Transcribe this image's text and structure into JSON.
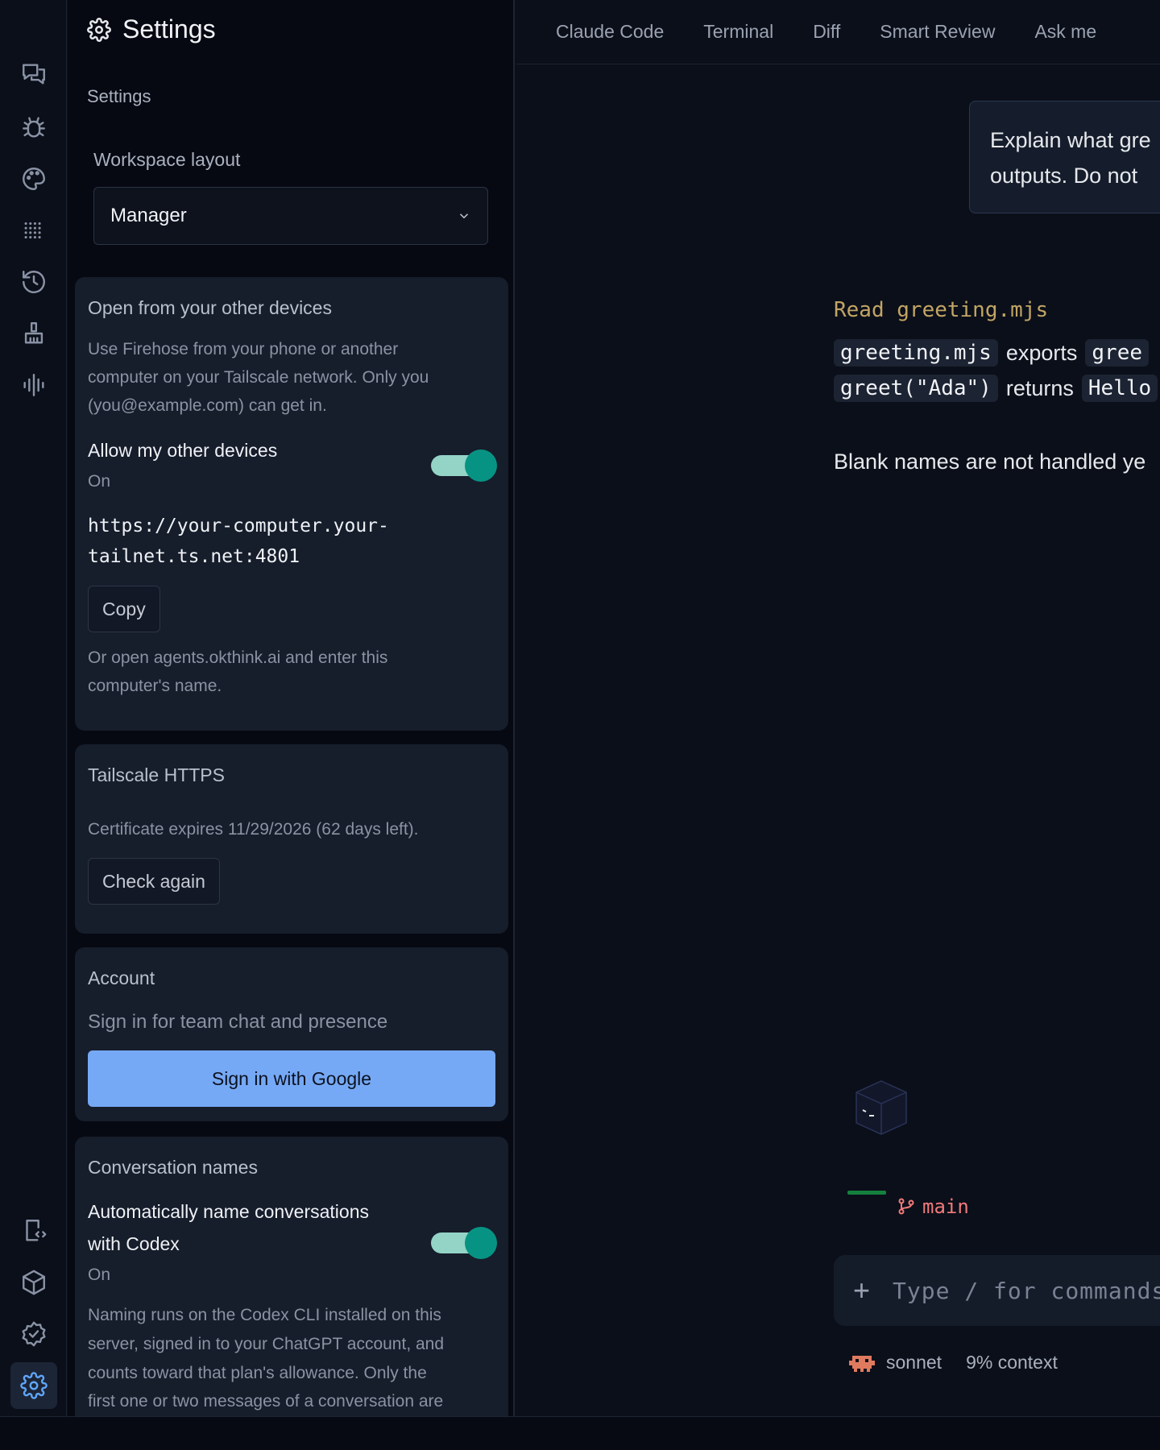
{
  "settings": {
    "title": "Settings",
    "subtitle": "Settings",
    "workspace_layout": {
      "label": "Workspace layout",
      "value": "Manager"
    },
    "devices": {
      "title": "Open from your other devices",
      "desc_line1": "Use Firehose from your phone or another",
      "desc_line2": "computer on your Tailscale network. Only you",
      "desc_line3": "(you@example.com) can get in.",
      "toggle_label": "Allow my other devices",
      "toggle_state": "On",
      "url_line1": "https://your-computer.your-",
      "url_line2": "tailnet.ts.net:4801",
      "copy_label": "Copy",
      "alt_line1": "Or open agents.okthink.ai and enter this",
      "alt_line2": "computer's name."
    },
    "tailscale": {
      "title": "Tailscale HTTPS",
      "cert_text": "Certificate expires 11/29/2026 (62 days left).",
      "check_label": "Check again"
    },
    "account": {
      "title": "Account",
      "subtitle": "Sign in for team chat and presence",
      "google_label": "Sign in with Google"
    },
    "conversation_names": {
      "title": "Conversation names",
      "toggle_line1": "Automatically name conversations",
      "toggle_line2": "with Codex",
      "toggle_state": "On",
      "desc_line1": "Naming runs on the Codex CLI installed on this",
      "desc_line2": "server, signed in to your ChatGPT account, and",
      "desc_line3": "counts toward that plan's allowance. Only the",
      "desc_line4": "first one or two messages of a conversation are"
    }
  },
  "main": {
    "tabs": [
      "Claude Code",
      "Terminal",
      "Diff",
      "Smart Review",
      "Ask me"
    ],
    "user_message_line1": "Explain what gre",
    "user_message_line2": "outputs. Do not",
    "tool_call": "Read greeting.mjs",
    "answer_line1": {
      "code1": "greeting.mjs",
      "text": "exports",
      "code2": "gree"
    },
    "answer_line2": {
      "code1": "greet(\"Ada\")",
      "text": "returns",
      "code2": "Hello"
    },
    "answer_line3": "Blank names are not handled ye",
    "branch": "main",
    "composer_placeholder": "Type / for commands",
    "model": "sonnet",
    "context": "9% context"
  },
  "colors": {
    "accent": "#60a5fa",
    "toggle_on": "#079383",
    "primary_button": "#76a9f5",
    "branch": "#f07a7a",
    "tool": "#c2a565"
  }
}
